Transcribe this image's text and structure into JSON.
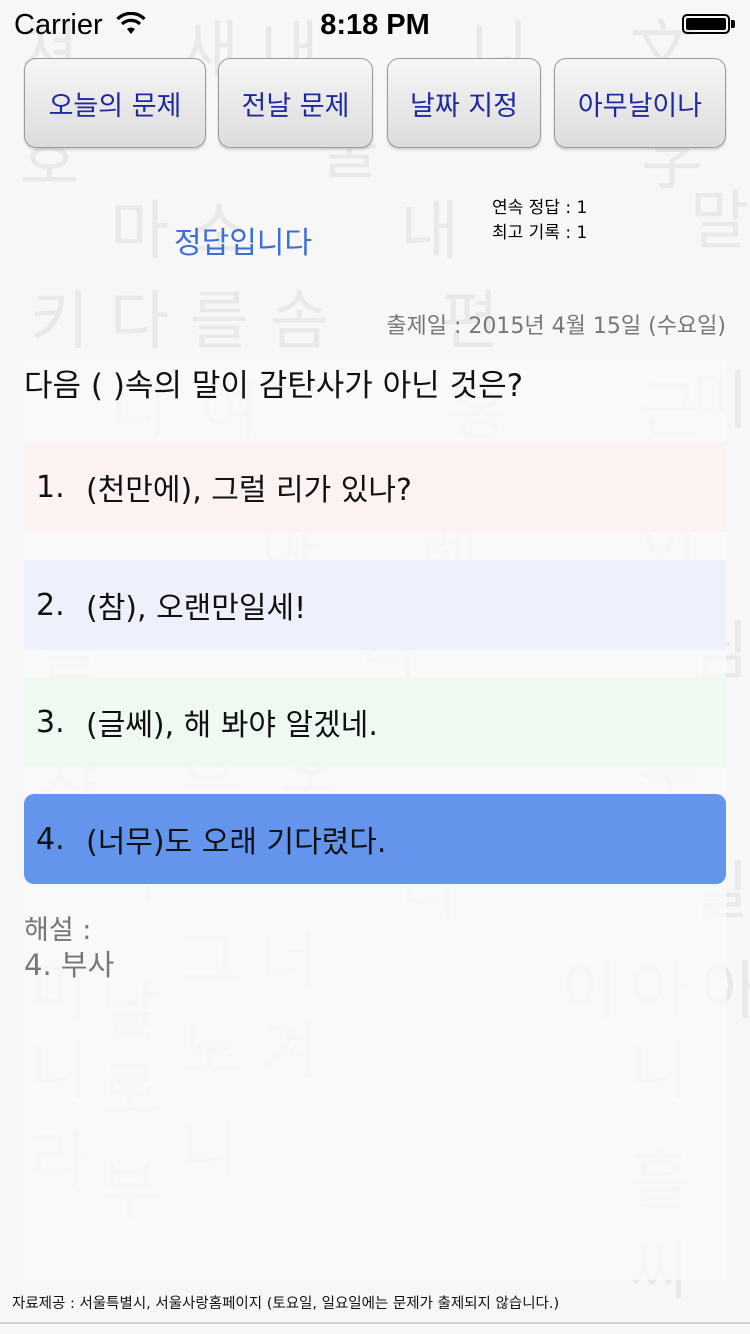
{
  "status_bar": {
    "carrier": "Carrier",
    "time": "8:18 PM"
  },
  "nav_buttons": {
    "today": "오늘의 문제",
    "previous": "전날 문제",
    "pick_date": "날짜 지정",
    "random": "아무날이나"
  },
  "result": {
    "message": "정답입니다"
  },
  "streak": {
    "current": "연속 정답 : 1",
    "best": "최고 기록 : 1"
  },
  "issue_date": "출제일 : 2015년 4월 15일 (수요일)",
  "question": "다음 ( )속의 말이 감탄사가 아닌 것은?",
  "options": [
    {
      "num": "1.",
      "text": "(천만에), 그럴 리가 있나?"
    },
    {
      "num": "2.",
      "text": "(참), 오랜만일세!"
    },
    {
      "num": "3.",
      "text": "(글쎄), 해 봐야 알겠네."
    },
    {
      "num": "4.",
      "text": "(너무)도 오래 기다렸다.",
      "selected": true
    }
  ],
  "explanation": {
    "title": "해설 :",
    "body": "4. 부사"
  },
  "footer": "자료제공 : 서울특별시, 서울사랑홈페이지  (토요일, 일요일에는 문제가 출제되지 않습니다.)",
  "colors": {
    "selected_option": "#6495ed",
    "result_text": "#3b6fd1",
    "button_text": "#1d2aa0"
  }
}
